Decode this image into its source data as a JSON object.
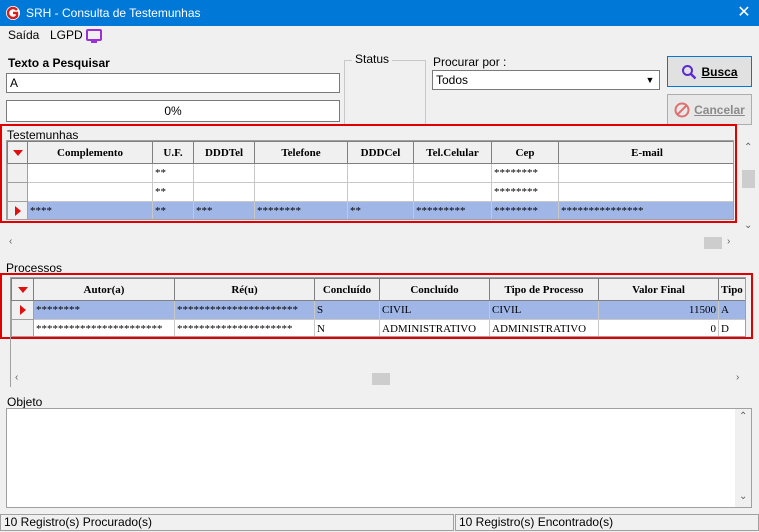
{
  "window": {
    "title": "SRH - Consulta de Testemunhas",
    "close_glyph": "✕"
  },
  "menu": {
    "items": [
      "Saída",
      "LGPD"
    ]
  },
  "search": {
    "label": "Texto a Pesquisar",
    "value": "A"
  },
  "progress": {
    "text": "0%",
    "value": 0
  },
  "status": {
    "label": "Status"
  },
  "procurar": {
    "label": "Procurar por :",
    "selected": "Todos"
  },
  "buttons": {
    "busca": "Busca",
    "cancelar": "Cancelar"
  },
  "testemunhas": {
    "label": "Testemunhas",
    "columns": [
      "Complemento",
      "U.F.",
      "DDDTel",
      "Telefone",
      "DDDCel",
      "Tel.Celular",
      "Cep",
      "E-mail"
    ],
    "rows": [
      [
        "",
        "**",
        "",
        "",
        "",
        "",
        "********",
        ""
      ],
      [
        "",
        "**",
        "",
        "",
        "",
        "",
        "********",
        ""
      ],
      [
        "****",
        "**",
        "***",
        "********",
        "**",
        "*********",
        "********",
        "***************"
      ]
    ],
    "selected_row": 2
  },
  "processos": {
    "label": "Processos",
    "columns": [
      "Autor(a)",
      "Ré(u)",
      "Concluído",
      "Concluído",
      "Tipo de Processo",
      "Valor Final",
      "Tipo"
    ],
    "rows": [
      [
        "********",
        "**********************",
        "S",
        "CIVIL",
        "CIVIL",
        "11500",
        "A"
      ],
      [
        "***********************",
        "*********************",
        "N",
        "ADMINISTRATIVO",
        "ADMINISTRATIVO",
        "0",
        "D"
      ]
    ],
    "selected_row": 0
  },
  "objeto": {
    "label": "Objeto"
  },
  "statusbar": {
    "left": "10 Registro(s) Procurado(s)",
    "right": "10 Registro(s) Encontrado(s)"
  },
  "colors": {
    "titlebar": "#0078d7",
    "selection": "#9fb6e6",
    "highlight_frame": "#e00000",
    "indicator": "#e01010"
  }
}
